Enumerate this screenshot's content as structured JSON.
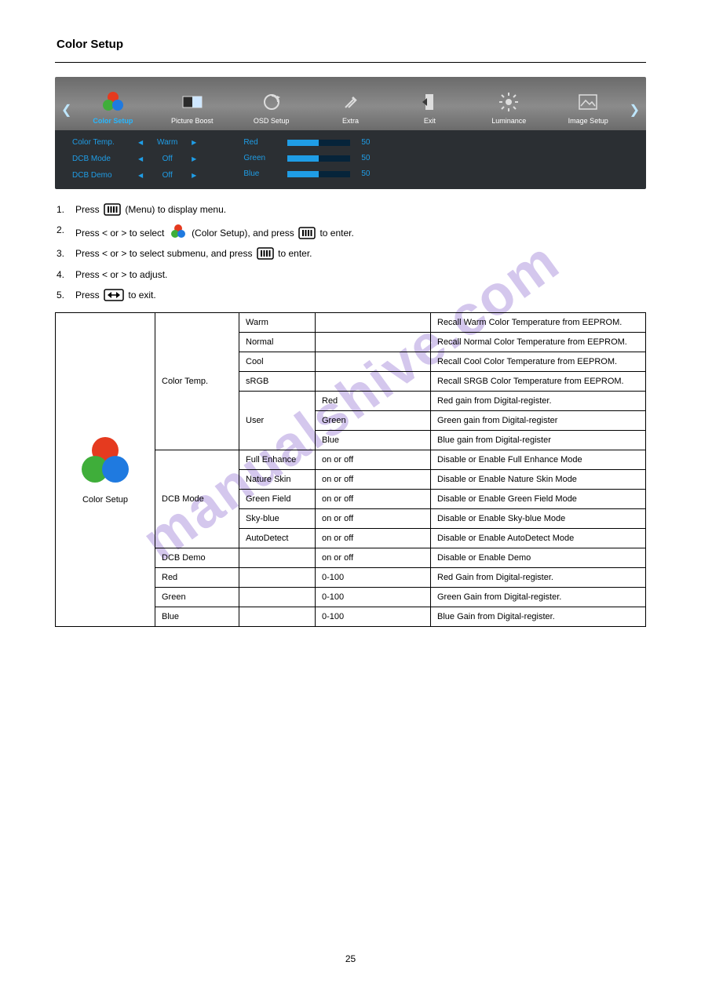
{
  "watermark": "manualshive.com",
  "section_title": "Color Setup",
  "page_number": "25",
  "osd": {
    "tabs": [
      {
        "label": "Color Setup",
        "active": true
      },
      {
        "label": "Picture Boost"
      },
      {
        "label": "OSD Setup"
      },
      {
        "label": "Extra"
      },
      {
        "label": "Exit"
      },
      {
        "label": "Luminance"
      },
      {
        "label": "Image Setup"
      }
    ],
    "left": [
      {
        "name": "Color Temp.",
        "value": "Warm"
      },
      {
        "name": "DCB Mode",
        "value": "Off"
      },
      {
        "name": "DCB Demo",
        "value": "Off"
      }
    ],
    "right": [
      {
        "name": "Red",
        "value": "50"
      },
      {
        "name": "Green",
        "value": "50"
      },
      {
        "name": "Blue",
        "value": "50"
      }
    ]
  },
  "instructions": {
    "s1a": "Press ",
    "s1b": " (Menu) to display menu.",
    "s2a": "Press < or > to select ",
    "s2b": " (Color Setup), and press ",
    "s2c": " to enter.",
    "s3a": "Press < or > to select submenu, and press ",
    "s3b": " to enter.",
    "s4": "Press < or > to adjust.",
    "s5a": "Press ",
    "s5b": " to exit."
  },
  "table": {
    "icon_caption": "Color Setup",
    "groups": [
      {
        "name": "Color Temp.",
        "rows": [
          {
            "c2": "Warm",
            "c3": "",
            "c4": "Recall Warm Color Temperature from EEPROM."
          },
          {
            "c2": "Normal",
            "c3": "",
            "c4": "Recall Normal Color Temperature from EEPROM."
          },
          {
            "c2": "Cool",
            "c3": "",
            "c4": "Recall Cool Color Temperature from EEPROM."
          },
          {
            "c2": "sRGB",
            "c3": "",
            "c4": "Recall SRGB Color Temperature from EEPROM."
          },
          {
            "c2": "",
            "c3": "Red",
            "c4": "Red gain from Digital-register."
          },
          {
            "c2": "User",
            "c3": "Green",
            "c4": "Green gain from Digital-register"
          },
          {
            "c2": "",
            "c3": "Blue",
            "c4": "Blue gain from Digital-register"
          }
        ]
      },
      {
        "name": "DCB Mode",
        "rows": [
          {
            "c2": "Full Enhance",
            "c3": "on or off",
            "c4": "Disable or Enable Full Enhance Mode"
          },
          {
            "c2": "Nature Skin",
            "c3": "on or off",
            "c4": "Disable or Enable Nature Skin Mode"
          },
          {
            "c2": "Green Field",
            "c3": "on or off",
            "c4": "Disable or Enable Green Field Mode"
          },
          {
            "c2": "Sky-blue",
            "c3": "on or off",
            "c4": "Disable or Enable Sky-blue Mode"
          },
          {
            "c2": "AutoDetect",
            "c3": "on or off",
            "c4": "Disable or Enable AutoDetect Mode"
          }
        ]
      },
      {
        "name": "DCB Demo",
        "rows": [
          {
            "c2": "",
            "c3": "on or off",
            "c4": "Disable or Enable Demo"
          }
        ]
      },
      {
        "name": "Red",
        "rows": [
          {
            "c2": "",
            "c3": "0-100",
            "c4": "Red Gain from Digital-register."
          }
        ]
      },
      {
        "name": "Green",
        "rows": [
          {
            "c2": "",
            "c3": "0-100",
            "c4": "Green Gain from Digital-register."
          }
        ]
      },
      {
        "name": "Blue",
        "rows": [
          {
            "c2": "",
            "c3": "0-100",
            "c4": "Blue Gain from Digital-register."
          }
        ]
      }
    ]
  }
}
